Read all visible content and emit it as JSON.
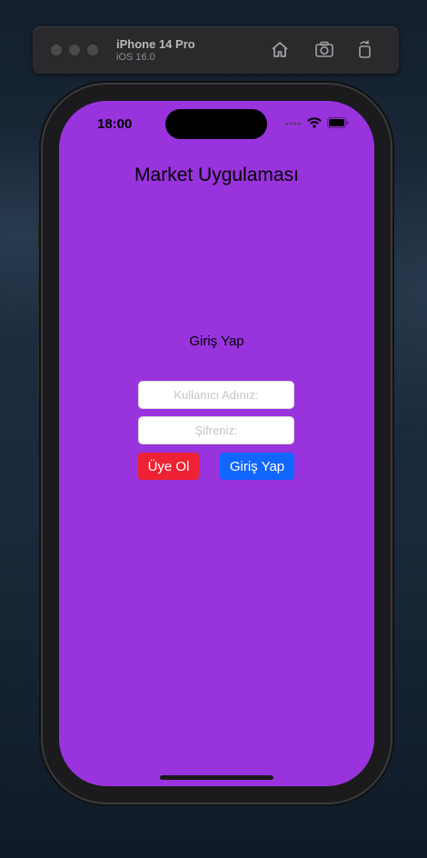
{
  "simulator": {
    "device_name": "iPhone 14 Pro",
    "os_version": "iOS 16.0",
    "icons": [
      "home-icon",
      "screenshot-icon",
      "rotate-icon"
    ]
  },
  "status_bar": {
    "time": "18:00",
    "icons": [
      "signal-icon",
      "wifi-icon",
      "battery-icon"
    ]
  },
  "app": {
    "title": "Market Uygulaması",
    "login_heading": "Giriş Yap",
    "username_placeholder": "Kullanıcı Adınız:",
    "password_placeholder": "Şifreniz:",
    "signup_label": "Üye Ol",
    "login_label": "Giriş Yap"
  },
  "colors": {
    "screen_background": "#9933dd",
    "signup_button": "#ee2233",
    "login_button": "#1166ff"
  }
}
